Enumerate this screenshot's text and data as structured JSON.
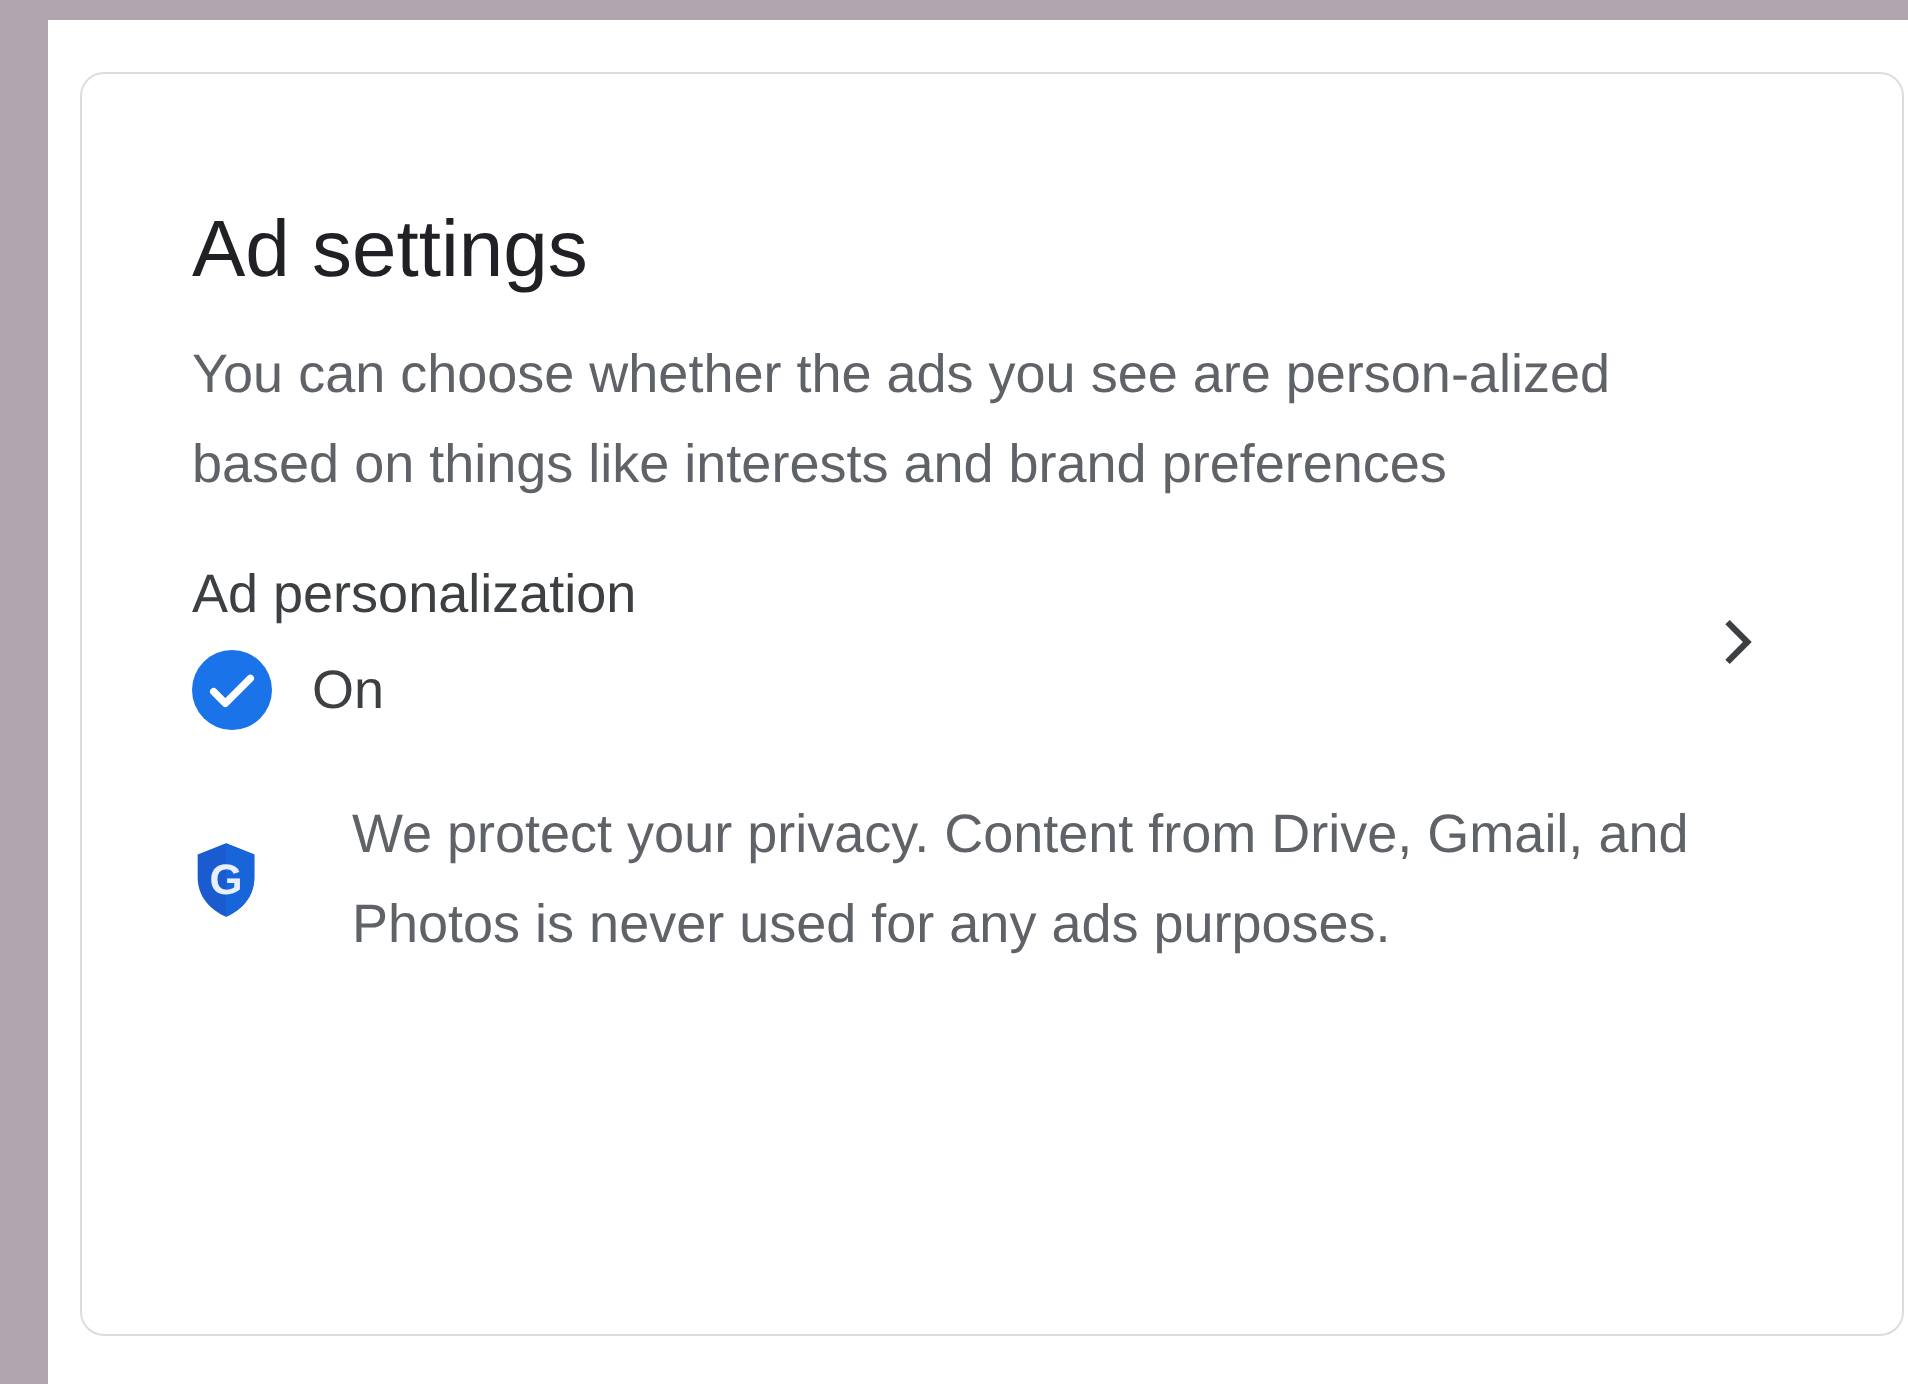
{
  "card": {
    "title": "Ad settings",
    "description": "You can choose whether the ads you see are person-alized based on things like interests and brand preferences",
    "setting": {
      "label": "Ad personalization",
      "on": true,
      "status": "On"
    },
    "privacy": {
      "mark": "G",
      "text": "We protect your privacy. Content from Drive, Gmail, and Photos is never used for any ads purposes."
    }
  }
}
